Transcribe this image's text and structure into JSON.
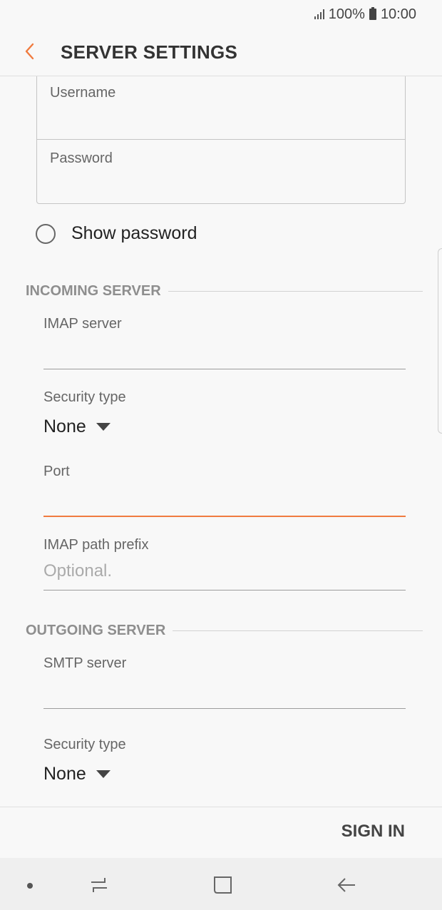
{
  "status_bar": {
    "battery": "100%",
    "time": "10:00"
  },
  "app_bar": {
    "title": "SERVER SETTINGS",
    "back_icon": "chevron-left-icon",
    "accent_color": "#f07b3f"
  },
  "account": {
    "username_label": "Username",
    "username_value": "",
    "password_label": "Password",
    "password_value": "",
    "show_password_label": "Show password",
    "show_password_checked": false
  },
  "incoming": {
    "section_title": "INCOMING SERVER",
    "server_label": "IMAP server",
    "server_value": "",
    "security_label": "Security type",
    "security_value": "None",
    "port_label": "Port",
    "port_value": "",
    "path_prefix_label": "IMAP path prefix",
    "path_prefix_placeholder": "Optional."
  },
  "outgoing": {
    "section_title": "OUTGOING SERVER",
    "server_label": "SMTP server",
    "server_value": "",
    "security_label": "Security type",
    "security_value": "None"
  },
  "footer": {
    "sign_in_label": "SIGN IN"
  },
  "nav_bar": {
    "icons": [
      "dot-icon",
      "recent-apps-icon",
      "home-icon",
      "back-arrow-icon"
    ]
  }
}
